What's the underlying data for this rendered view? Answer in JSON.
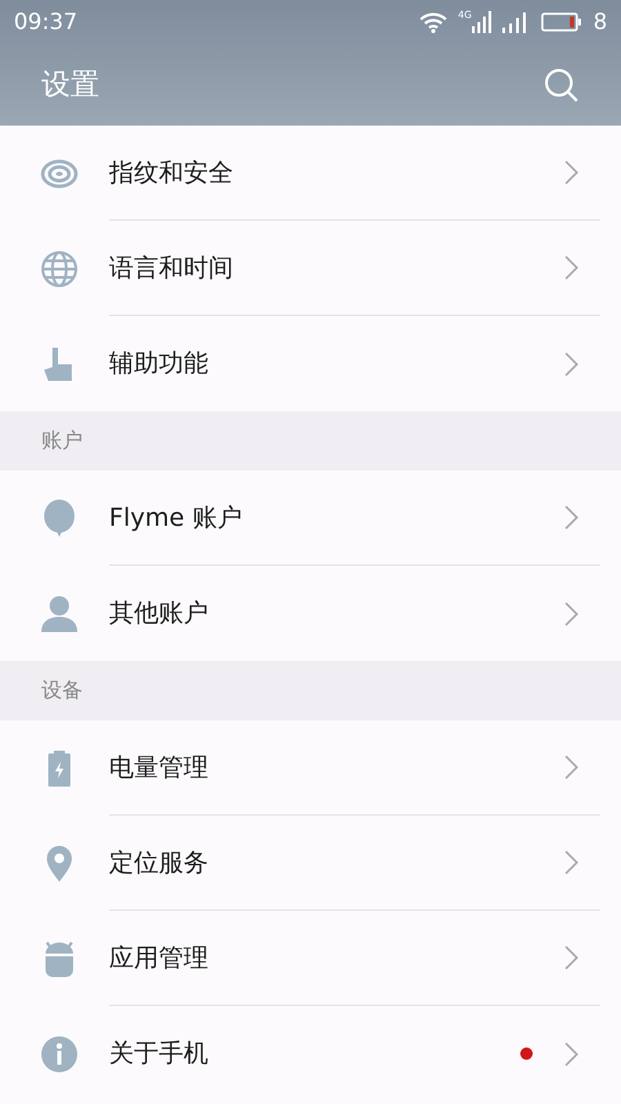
{
  "status_bar": {
    "time": "09:37",
    "network": "4G",
    "battery": "8"
  },
  "header": {
    "title": "设置"
  },
  "sections": [
    {
      "items": [
        {
          "label": "指纹和安全",
          "notice": false
        },
        {
          "label": "语言和时间",
          "notice": false
        },
        {
          "label": "辅助功能",
          "notice": false
        }
      ]
    },
    {
      "title": "账户",
      "items": [
        {
          "label": "Flyme 账户",
          "notice": false
        },
        {
          "label": "其他账户",
          "notice": false
        }
      ]
    },
    {
      "title": "设备",
      "items": [
        {
          "label": "电量管理",
          "notice": false
        },
        {
          "label": "定位服务",
          "notice": false
        },
        {
          "label": "应用管理",
          "notice": false
        },
        {
          "label": "关于手机",
          "notice": true
        }
      ]
    }
  ]
}
